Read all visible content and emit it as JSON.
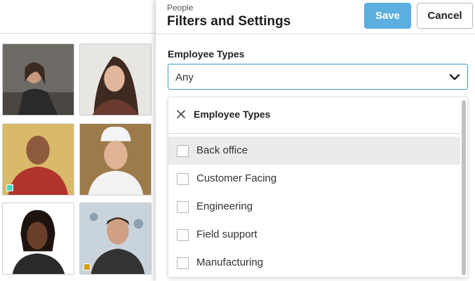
{
  "panel": {
    "eyebrow": "People",
    "title": "Filters and Settings",
    "save_label": "Save",
    "cancel_label": "Cancel",
    "accent_color": "#5aaee0"
  },
  "field": {
    "label": "Employee Types",
    "value": "Any",
    "icon": "chevron-down-icon"
  },
  "dropdown": {
    "title": "Employee Types",
    "close_icon": "close-icon",
    "items": [
      {
        "label": "Back office",
        "checked": false,
        "highlighted": true
      },
      {
        "label": "Customer Facing",
        "checked": false
      },
      {
        "label": "Engineering",
        "checked": false
      },
      {
        "label": "Field support",
        "checked": false
      },
      {
        "label": "Manufacturing",
        "checked": false
      }
    ]
  },
  "people_grid": {
    "markers": [
      {
        "tile": 3,
        "color": "#4fd1c5"
      },
      {
        "tile": 6,
        "color": "#d4a017"
      }
    ]
  }
}
